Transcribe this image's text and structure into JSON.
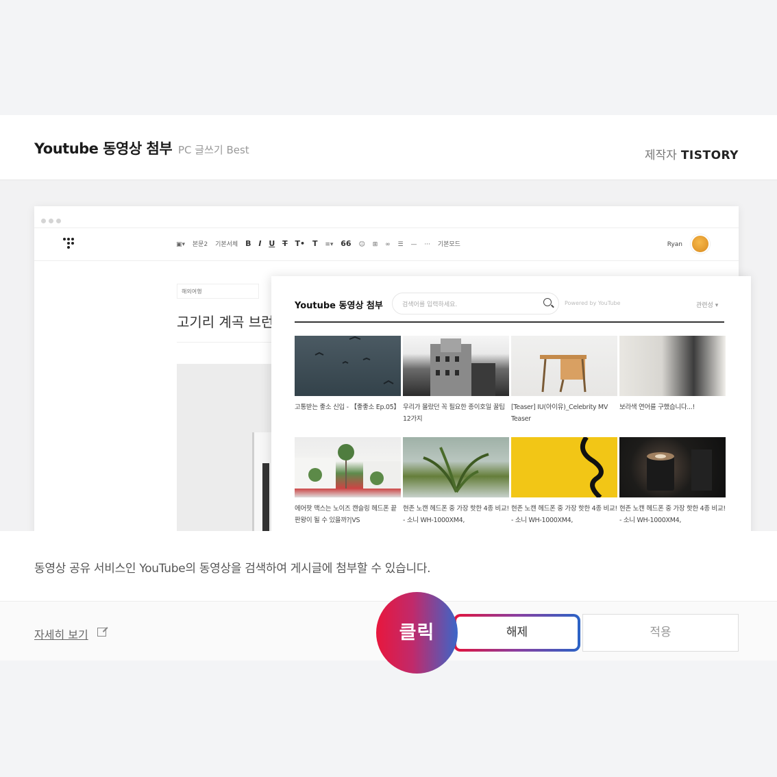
{
  "header": {
    "title": "Youtube 동영상 첨부",
    "subtitle": "PC 글쓰기 Best",
    "maker_label": "제작자",
    "maker_name": "TISTORY"
  },
  "editor": {
    "toolbar": {
      "items": [
        "본문2",
        "기본서체",
        "B",
        "I",
        "U",
        "T",
        "T",
        "T",
        "66",
        "기본모드"
      ],
      "image_label": "",
      "paragraph": "본문2",
      "font": "기본서체",
      "mode": "기본모드"
    },
    "user_name": "Ryan",
    "category": "해외여행",
    "post_title": "고기리 계곡 브런"
  },
  "modal": {
    "title": "Youtube 동영상 첨부",
    "search_placeholder": "검색어를 입력하세요.",
    "powered": "Powered by YouTube",
    "sort": "관련성",
    "videos": [
      {
        "caption": "고통받는 좋소 신입 - 【좋좋소 Ep.05】"
      },
      {
        "caption": "우리가 몰랐던 꼭 필요한 종이호일 꿀팁 12가지"
      },
      {
        "caption": "[Teaser] IU(아이유)_Celebrity MV Teaser"
      },
      {
        "caption": "보라색 연어를 구했습니다...!"
      },
      {
        "caption": "에어팟 맥스는 노이즈 캔슬링 헤드폰 끝판왕이 될 수 있을까?|VS"
      },
      {
        "caption": "현존 노캔 헤드폰 중 가장 핫한 4종 비교! - 소니 WH-1000XM4,"
      },
      {
        "caption": "현존 노캔 헤드폰 중 가장 핫한 4종 비교! - 소니 WH-1000XM4,"
      },
      {
        "caption": "현존 노캔 헤드폰 중 가장 핫한 4종 비교! - 소니 WH-1000XM4,"
      }
    ]
  },
  "description": "동영상 공유 서비스인 YouTube의 동영상을 검색하여 게시글에 첨부할 수 있습니다.",
  "footer": {
    "more_link": "자세히 보기",
    "release_button": "해제",
    "apply_button": "적용",
    "click_badge": "클릭"
  },
  "colors": {
    "badge_start": "#e8173d",
    "badge_end": "#3b66c9"
  }
}
